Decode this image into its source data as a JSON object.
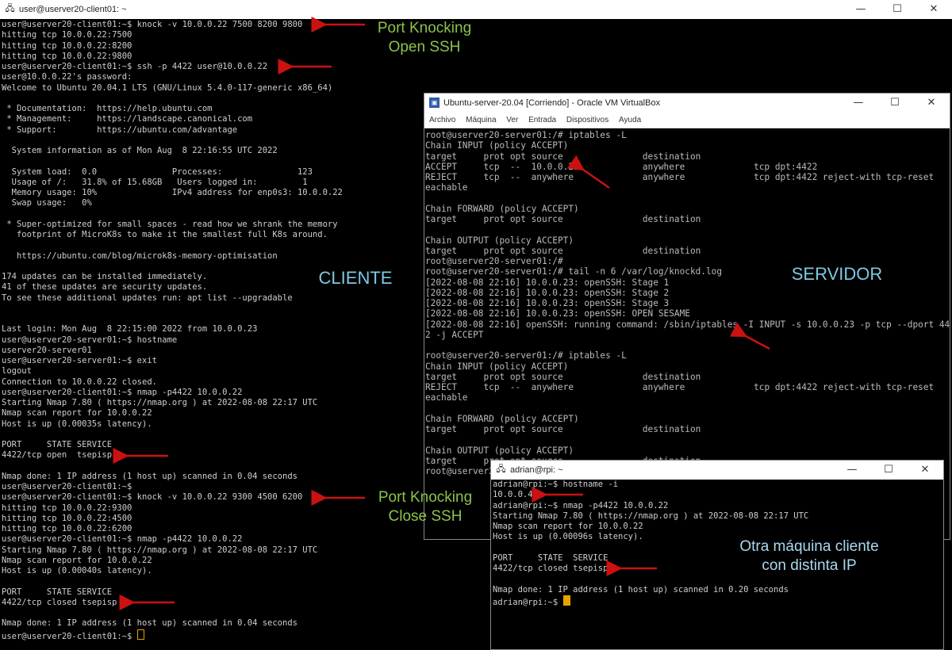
{
  "client_window": {
    "title": "user@userver20-client01: ~",
    "icon": "putty-icon",
    "lines": [
      "user@userver20-client01:~$ knock -v 10.0.0.22 7500 8200 9800",
      "hitting tcp 10.0.0.22:7500",
      "hitting tcp 10.0.0.22:8200",
      "hitting tcp 10.0.0.22:9800",
      "user@userver20-client01:~$ ssh -p 4422 user@10.0.0.22",
      "user@10.0.0.22's password:",
      "Welcome to Ubuntu 20.04.1 LTS (GNU/Linux 5.4.0-117-generic x86_64)",
      "",
      " * Documentation:  https://help.ubuntu.com",
      " * Management:     https://landscape.canonical.com",
      " * Support:        https://ubuntu.com/advantage",
      "",
      "  System information as of Mon Aug  8 22:16:55 UTC 2022",
      "",
      "  System load:  0.0               Processes:               123",
      "  Usage of /:   31.8% of 15.68GB   Users logged in:         1",
      "  Memory usage: 10%               IPv4 address for enp0s3: 10.0.0.22",
      "  Swap usage:   0%",
      "",
      " * Super-optimized for small spaces - read how we shrank the memory",
      "   footprint of MicroK8s to make it the smallest full K8s around.",
      "",
      "   https://ubuntu.com/blog/microk8s-memory-optimisation",
      "",
      "174 updates can be installed immediately.",
      "41 of these updates are security updates.",
      "To see these additional updates run: apt list --upgradable",
      "",
      "",
      "Last login: Mon Aug  8 22:15:00 2022 from 10.0.0.23",
      "user@userver20-server01:~$ hostname",
      "userver20-server01",
      "user@userver20-server01:~$ exit",
      "logout",
      "Connection to 10.0.0.22 closed.",
      "user@userver20-client01:~$ nmap -p4422 10.0.0.22",
      "Starting Nmap 7.80 ( https://nmap.org ) at 2022-08-08 22:17 UTC",
      "Nmap scan report for 10.0.0.22",
      "Host is up (0.00035s latency).",
      "",
      "PORT     STATE SERVICE",
      "4422/tcp open  tsepisp",
      "",
      "Nmap done: 1 IP address (1 host up) scanned in 0.04 seconds",
      "user@userver20-client01:~$",
      "user@userver20-client01:~$ knock -v 10.0.0.22 9300 4500 6200",
      "hitting tcp 10.0.0.22:9300",
      "hitting tcp 10.0.0.22:4500",
      "hitting tcp 10.0.0.22:6200",
      "user@userver20-client01:~$ nmap -p4422 10.0.0.22",
      "Starting Nmap 7.80 ( https://nmap.org ) at 2022-08-08 22:17 UTC",
      "Nmap scan report for 10.0.0.22",
      "Host is up (0.00040s latency).",
      "",
      "PORT     STATE SERVICE",
      "4422/tcp closed tsepisp",
      "",
      "Nmap done: 1 IP address (1 host up) scanned in 0.04 seconds"
    ],
    "prompt": "user@userver20-client01:~$ "
  },
  "server_window": {
    "title": "Ubuntu-server-20.04 [Corriendo] - Oracle VM VirtualBox",
    "icon": "virtualbox-icon",
    "menu": [
      "Archivo",
      "Máquina",
      "Ver",
      "Entrada",
      "Dispositivos",
      "Ayuda"
    ],
    "lines": [
      "root@userver20-server01:/# iptables -L",
      "Chain INPUT (policy ACCEPT)",
      "target     prot opt source               destination",
      "ACCEPT     tcp  --  10.0.0.23            anywhere             tcp dpt:4422",
      "REJECT     tcp  --  anywhere             anywhere             tcp dpt:4422 reject-with tcp-reset",
      "eachable",
      "",
      "Chain FORWARD (policy ACCEPT)",
      "target     prot opt source               destination",
      "",
      "Chain OUTPUT (policy ACCEPT)",
      "target     prot opt source               destination",
      "root@userver20-server01:/#",
      "root@userver20-server01:/# tail -n 6 /var/log/knockd.log",
      "[2022-08-08 22:16] 10.0.0.23: openSSH: Stage 1",
      "[2022-08-08 22:16] 10.0.0.23: openSSH: Stage 2",
      "[2022-08-08 22:16] 10.0.0.23: openSSH: Stage 3",
      "[2022-08-08 22:16] 10.0.0.23: openSSH: OPEN SESAME",
      "[2022-08-08 22:16] openSSH: running command: /sbin/iptables -I INPUT -s 10.0.0.23 -p tcp --dport 442",
      "2 -j ACCEPT",
      "",
      "root@userver20-server01:/# iptables -L",
      "Chain INPUT (policy ACCEPT)",
      "target     prot opt source               destination",
      "REJECT     tcp  --  anywhere             anywhere             tcp dpt:4422 reject-with tcp-reset",
      "eachable",
      "",
      "Chain FORWARD (policy ACCEPT)",
      "target     prot opt source               destination",
      "",
      "Chain OUTPUT (policy ACCEPT)",
      "target     prot opt source               destination",
      "root@userver20-server01:/#"
    ]
  },
  "rpi_window": {
    "title": "adrian@rpi: ~",
    "icon": "putty-icon",
    "lines": [
      "adrian@rpi:~$ hostname -i",
      "10.0.0.40",
      "adrian@rpi:~$ nmap -p4422 10.0.0.22",
      "Starting Nmap 7.80 ( https://nmap.org ) at 2022-08-08 22:17 UTC",
      "Nmap scan report for 10.0.0.22",
      "Host is up (0.00096s latency).",
      "",
      "PORT     STATE  SERVICE",
      "4422/tcp closed tsepisp",
      "",
      "Nmap done: 1 IP address (1 host up) scanned in 0.20 seconds"
    ],
    "prompt": "adrian@rpi:~$ "
  },
  "window_controls": {
    "minimize": "—",
    "maximize": "☐",
    "close": "✕"
  },
  "annotations": {
    "open_ssh": [
      "Port Knocking",
      "Open SSH"
    ],
    "close_ssh": [
      "Port Knocking",
      "Close SSH"
    ],
    "cliente": "CLIENTE",
    "servidor": "SERVIDOR",
    "otra": [
      "Otra máquina cliente",
      "con distinta IP"
    ]
  },
  "colors": {
    "annotation_green": "#8bc34a",
    "annotation_blue": "#7ec8e3",
    "annotation_white": "#a9d8ef",
    "arrow_red": "#cc1111",
    "cursor": "#e6a400"
  }
}
